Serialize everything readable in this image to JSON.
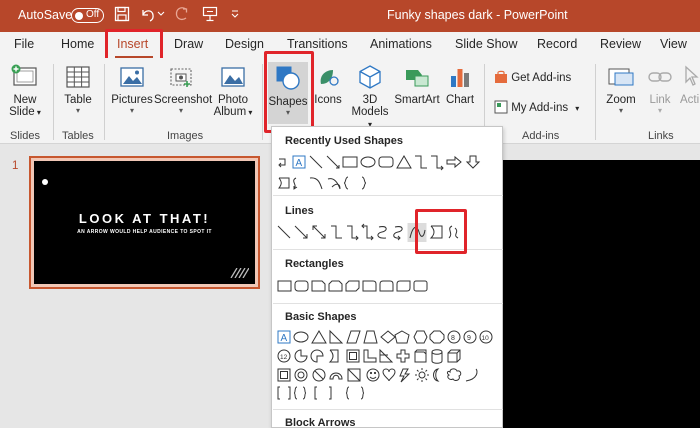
{
  "titlebar": {
    "autosave_label": "AutoSave",
    "autosave_state": "Off",
    "document_title": "Funky shapes dark  -  PowerPoint",
    "color": "#b7472a"
  },
  "tabs": [
    {
      "label": "File"
    },
    {
      "label": "Home"
    },
    {
      "label": "Insert",
      "active": true
    },
    {
      "label": "Draw"
    },
    {
      "label": "Design"
    },
    {
      "label": "Transitions"
    },
    {
      "label": "Animations"
    },
    {
      "label": "Slide Show"
    },
    {
      "label": "Record"
    },
    {
      "label": "Review"
    },
    {
      "label": "View"
    }
  ],
  "ribbon": {
    "new_slide": {
      "line1": "New",
      "line2": "Slide"
    },
    "table": "Table",
    "pictures": "Pictures",
    "screenshot": "Screenshot",
    "photo_album": {
      "line1": "Photo",
      "line2": "Album"
    },
    "shapes": "Shapes",
    "icons": "Icons",
    "models_3d": {
      "line1": "3D",
      "line2": "Models"
    },
    "smartart": "SmartArt",
    "chart": "Chart",
    "get_addins": "Get Add-ins",
    "my_addins": "My Add-ins",
    "zoom": "Zoom",
    "link": "Link",
    "action": "Acti",
    "groups": {
      "slides": "Slides",
      "tables": "Tables",
      "images": "Images",
      "addins": "Add-ins",
      "links": "Links"
    }
  },
  "slide_panel": {
    "slide_number": "1",
    "title": "LOOK AT THAT!",
    "subtitle": "AN ARROW WOULD HELP AUDIENCE TO SPOT IT"
  },
  "shapes_menu": {
    "sections": {
      "recent": "Recently Used Shapes",
      "lines": "Lines",
      "rectangles": "Rectangles",
      "basic": "Basic Shapes",
      "block_arrows": "Block Arrows"
    },
    "highlighted_shape": "curve-icon"
  },
  "colors": {
    "accent": "#b7472a",
    "highlight": "#e0242a",
    "ribbon_bg": "#f3f3f3"
  }
}
